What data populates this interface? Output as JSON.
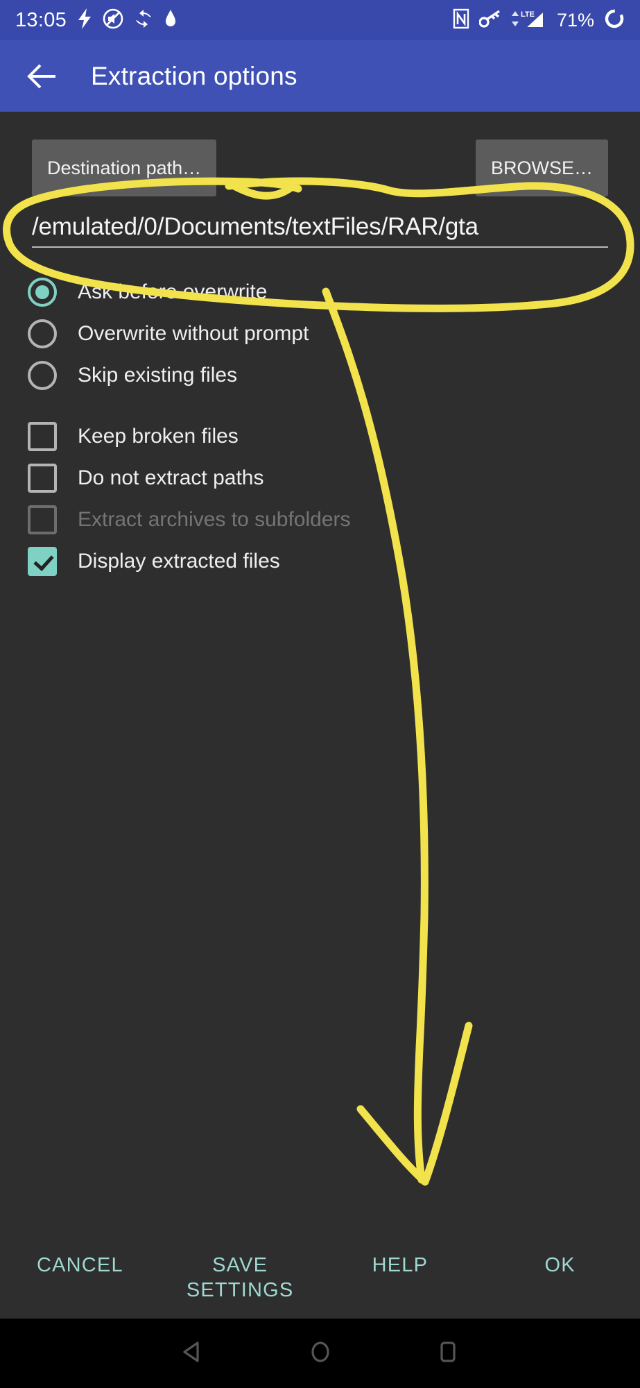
{
  "status_bar": {
    "clock": "13:05",
    "battery": "71%",
    "network_label": "LTE",
    "icons_left": [
      "flash-icon",
      "no-sound-icon",
      "sync-icon",
      "drop-icon"
    ],
    "icons_right": [
      "nfc-icon",
      "key-icon",
      "lte-signal-icon",
      "loading-circle-icon"
    ],
    "background_color": "#3949ab"
  },
  "app_bar": {
    "back_label": "back-arrow",
    "title": "Extraction options",
    "background_color": "#3f51b5"
  },
  "path_row": {
    "destination_label": "Destination path…",
    "browse_label": "BROWSE…"
  },
  "path_field": {
    "value": "/emulated/0/Documents/textFiles/RAR/gta"
  },
  "overwrite_options": [
    {
      "label": "Ask before overwrite",
      "checked": true
    },
    {
      "label": "Overwrite without prompt",
      "checked": false
    },
    {
      "label": "Skip existing files",
      "checked": false
    }
  ],
  "checkbox_options": [
    {
      "label": "Keep broken files",
      "checked": false,
      "disabled": false
    },
    {
      "label": "Do not extract paths",
      "checked": false,
      "disabled": false
    },
    {
      "label": "Extract archives to subfolders",
      "checked": false,
      "disabled": true
    },
    {
      "label": "Display extracted files",
      "checked": true,
      "disabled": false
    }
  ],
  "action_bar": {
    "cancel": "CANCEL",
    "save_settings": "SAVE SETTINGS",
    "help": "HELP",
    "ok": "OK"
  },
  "nav_bar": {
    "back": "nav-back-triangle-icon",
    "home": "nav-home-circle-icon",
    "recents": "nav-recents-square-icon"
  },
  "annotation": {
    "color": "#f2e34c",
    "shapes": [
      "ellipse-around-path-field",
      "arrow-to-bottom-right"
    ]
  },
  "theme": {
    "accent": "#7fd1c4",
    "page_background": "#2e2e2e",
    "chip_background": "#5c5c5c",
    "action_text": "#9fd8cf"
  }
}
